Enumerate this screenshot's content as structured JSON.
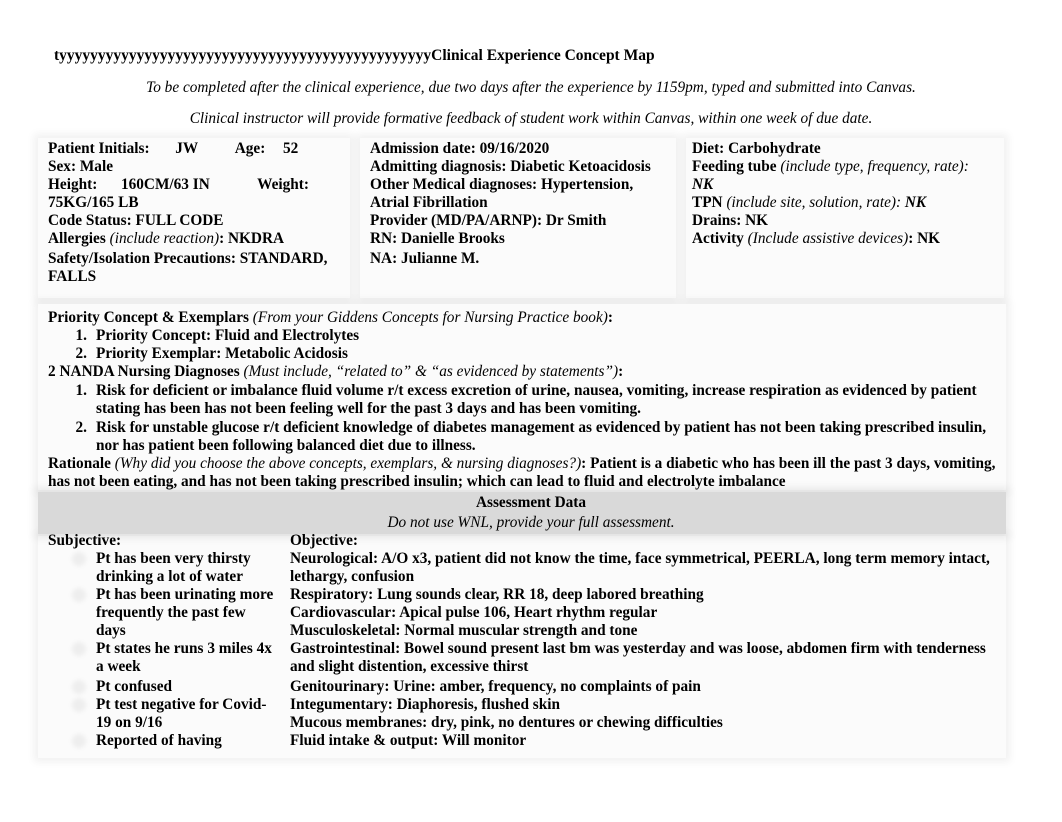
{
  "header": {
    "title": "tyyyyyyyyyyyyyyyyyyyyyyyyyyyyyyyyyyyyyyyyyyyyyyyyClinical Experience Concept Map",
    "instruction_1": "To be completed after the clinical experience, due two days after the experience by 1159pm, typed and submitted into Canvas.",
    "instruction_2": "Clinical instructor will provide formative feedback of student work within Canvas, within one week of due date."
  },
  "patient": {
    "initials_label": "Patient Initials:",
    "initials": "JW",
    "age_label": "Age:",
    "age": "52",
    "sex": "Sex: Male",
    "height_label": "Height:",
    "height": "160CM/63 IN",
    "weight_label": "Weight:",
    "weight": "75KG/165 LB",
    "code_status": "Code Status: FULL CODE",
    "allergies_label": "Allergies",
    "allergies_hint": "(include reaction)",
    "allergies_value": ": NKDRA",
    "safety": "Safety/Isolation Precautions: STANDARD, FALLS"
  },
  "admission": {
    "date": "Admission date: 09/16/2020",
    "admitting_dx": "Admitting diagnosis: Diabetic Ketoacidosis",
    "other_dx": "Other Medical diagnoses: Hypertension, Atrial Fibrillation",
    "provider": "Provider (MD/PA/ARNP): Dr Smith",
    "rn": "RN: Danielle Brooks",
    "na": "NA: Julianne M."
  },
  "care": {
    "diet": "Diet: Carbohydrate",
    "feeding_label": "Feeding tube",
    "feeding_hint": "(include type, frequency, rate):",
    "feeding_value": "NK",
    "tpn_label": "TPN",
    "tpn_hint": "(include site, solution, rate):",
    "tpn_value": "NK",
    "drains": "Drains: NK",
    "activity_label": "Activity",
    "activity_hint": "(Include assistive devices)",
    "activity_value": ": NK"
  },
  "priority": {
    "heading": "Priority Concept & Exemplars",
    "hint": "(From your Giddens Concepts for Nursing Practice book)",
    "colon": ":",
    "items": [
      {
        "num": "1.",
        "text": "Priority Concept: Fluid and Electrolytes"
      },
      {
        "num": "2.",
        "text": "Priority Exemplar: Metabolic Acidosis"
      }
    ]
  },
  "nanda": {
    "heading": "2 NANDA Nursing Diagnoses",
    "hint": "(Must include, “related to” & “as evidenced by statements”)",
    "colon": ":",
    "items": [
      {
        "num": "1.",
        "text": "Risk for deficient or imbalance fluid volume r/t excess excretion of urine, nausea, vomiting, increase respiration as evidenced by patient stating has been has not been feeling well for the past 3 days and has been vomiting."
      },
      {
        "num": "2.",
        "text": "Risk for unstable glucose r/t deficient knowledge of diabetes management as evidenced by patient has not been taking prescribed insulin, nor has patient been following balanced diet due to illness."
      }
    ]
  },
  "rationale": {
    "label": "Rationale",
    "hint": "(Why did you choose the above concepts, exemplars, & nursing diagnoses?)",
    "text": ": Patient is a diabetic who has been ill the past 3 days, vomiting, has not been eating, and has not been taking prescribed insulin; which can lead to fluid and electrolyte imbalance"
  },
  "assessment": {
    "title": "Assessment Data",
    "subtitle": "Do not use WNL, provide your full assessment.",
    "subjective_label": "Subjective:",
    "subjective": [
      "Pt has been very thirsty drinking a lot of water",
      "Pt has been urinating more frequently the past few days",
      "Pt states he runs 3 miles 4x a week",
      "Pt confused",
      "Pt test negative for Covid-19 on 9/16",
      "Reported of having"
    ],
    "objective_label": "Objective:",
    "objective": [
      "Neurological: A/O x3, patient did not know the time, face symmetrical, PEERLA, long term memory intact, lethargy, confusion",
      "Respiratory: Lung sounds clear, RR 18, deep labored breathing",
      "Cardiovascular: Apical pulse 106, Heart rhythm regular",
      "Musculoskeletal: Normal muscular strength and tone",
      "Gastrointestinal: Bowel sound present last bm was yesterday and was loose, abdomen firm with tenderness and slight distention, excessive thirst",
      "Genitourinary: Urine: amber, frequency, no complaints of pain",
      "Integumentary: Diaphoresis, flushed skin",
      "Mucous membranes: dry, pink, no dentures or chewing difficulties",
      "Fluid intake & output: Will monitor"
    ]
  }
}
